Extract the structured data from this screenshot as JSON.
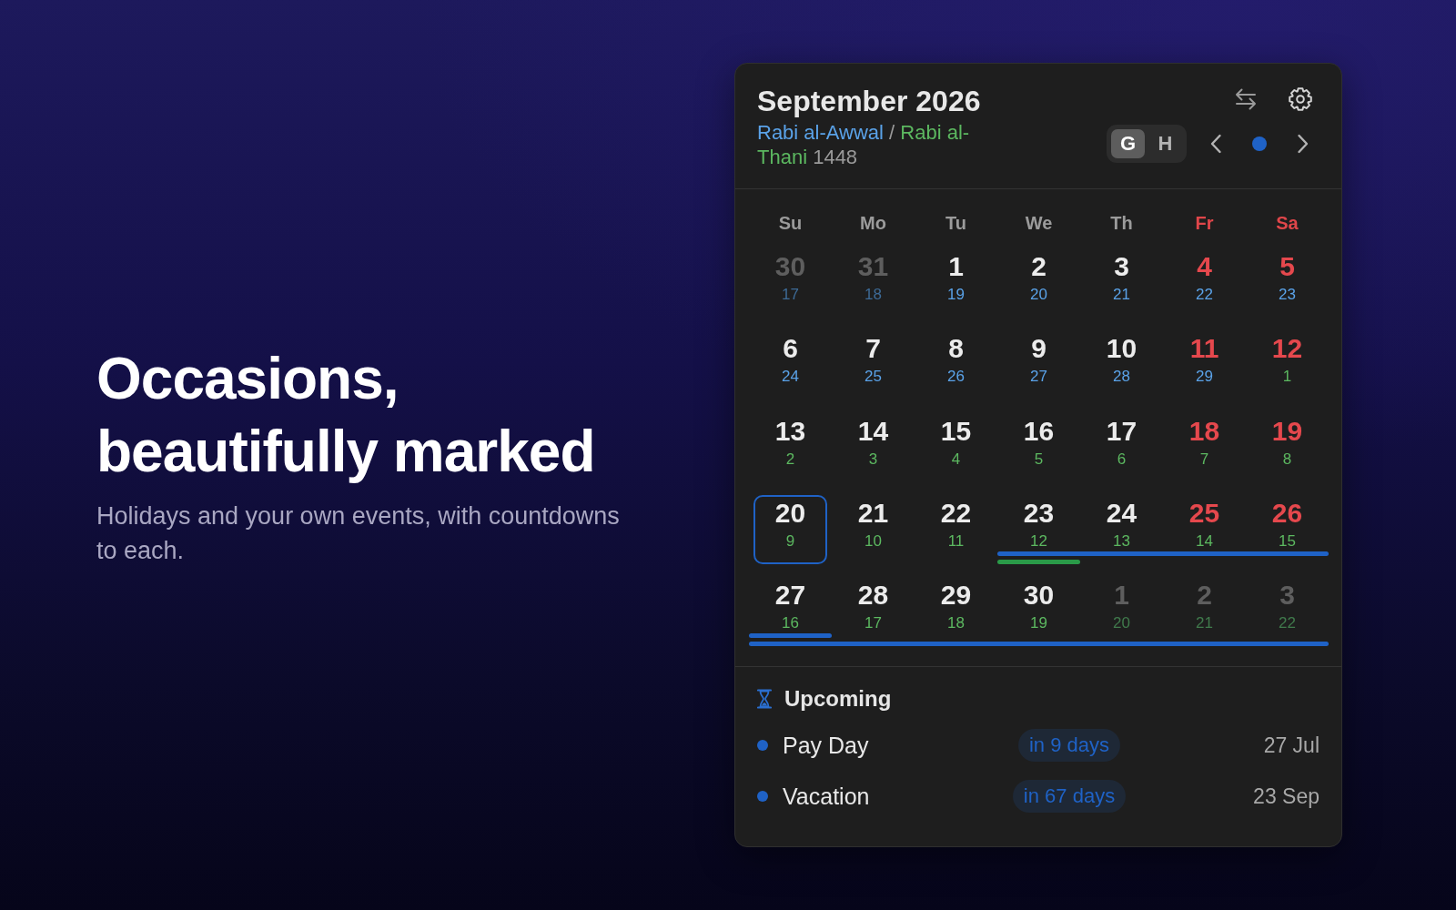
{
  "hero": {
    "headline": "Occasions, beautifully marked",
    "subtitle": "Holidays and your own events, with countdowns to each."
  },
  "calendar": {
    "title": "September 2026",
    "hijri_months": [
      {
        "name": "Rabi al-Awwal",
        "color": "#5aa2e8"
      },
      {
        "name": "Rabi al-Thani",
        "color": "#5cb860"
      }
    ],
    "hijri_separator": "/",
    "hijri_year": "1448",
    "modes": [
      {
        "label": "G",
        "selected": true
      },
      {
        "label": "H",
        "selected": false
      }
    ],
    "weekdays": [
      {
        "label": "Su",
        "weekend": false
      },
      {
        "label": "Mo",
        "weekend": false
      },
      {
        "label": "Tu",
        "weekend": false
      },
      {
        "label": "We",
        "weekend": false
      },
      {
        "label": "Th",
        "weekend": false
      },
      {
        "label": "Fr",
        "weekend": true
      },
      {
        "label": "Sa",
        "weekend": true
      }
    ],
    "weeks": [
      {
        "days": [
          {
            "date": "30",
            "hijri": "17",
            "color": "#3d6a96",
            "outside": true,
            "selected": false
          },
          {
            "date": "31",
            "hijri": "18",
            "color": "#3d6a96",
            "outside": true,
            "selected": false
          },
          {
            "date": "1",
            "hijri": "19",
            "color": "#5aa2e8",
            "outside": false,
            "selected": false
          },
          {
            "date": "2",
            "hijri": "20",
            "color": "#5aa2e8",
            "outside": false,
            "selected": false
          },
          {
            "date": "3",
            "hijri": "21",
            "color": "#5aa2e8",
            "outside": false,
            "selected": false
          },
          {
            "date": "4",
            "hijri": "22",
            "color": "#5aa2e8",
            "outside": false,
            "selected": false
          },
          {
            "date": "5",
            "hijri": "23",
            "color": "#5aa2e8",
            "outside": false,
            "selected": false
          }
        ]
      },
      {
        "days": [
          {
            "date": "6",
            "hijri": "24",
            "color": "#5aa2e8",
            "outside": false,
            "selected": false
          },
          {
            "date": "7",
            "hijri": "25",
            "color": "#5aa2e8",
            "outside": false,
            "selected": false
          },
          {
            "date": "8",
            "hijri": "26",
            "color": "#5aa2e8",
            "outside": false,
            "selected": false
          },
          {
            "date": "9",
            "hijri": "27",
            "color": "#5aa2e8",
            "outside": false,
            "selected": false
          },
          {
            "date": "10",
            "hijri": "28",
            "color": "#5aa2e8",
            "outside": false,
            "selected": false
          },
          {
            "date": "11",
            "hijri": "29",
            "color": "#5aa2e8",
            "outside": false,
            "selected": false
          },
          {
            "date": "12",
            "hijri": "1",
            "color": "#5cb860",
            "outside": false,
            "selected": false
          }
        ]
      },
      {
        "days": [
          {
            "date": "13",
            "hijri": "2",
            "color": "#5cb860",
            "outside": false,
            "selected": false
          },
          {
            "date": "14",
            "hijri": "3",
            "color": "#5cb860",
            "outside": false,
            "selected": false
          },
          {
            "date": "15",
            "hijri": "4",
            "color": "#5cb860",
            "outside": false,
            "selected": false
          },
          {
            "date": "16",
            "hijri": "5",
            "color": "#5cb860",
            "outside": false,
            "selected": false
          },
          {
            "date": "17",
            "hijri": "6",
            "color": "#5cb860",
            "outside": false,
            "selected": false
          },
          {
            "date": "18",
            "hijri": "7",
            "color": "#5cb860",
            "outside": false,
            "selected": false
          },
          {
            "date": "19",
            "hijri": "8",
            "color": "#5cb860",
            "outside": false,
            "selected": false
          }
        ]
      },
      {
        "days": [
          {
            "date": "20",
            "hijri": "9",
            "color": "#5cb860",
            "outside": false,
            "selected": true
          },
          {
            "date": "21",
            "hijri": "10",
            "color": "#5cb860",
            "outside": false,
            "selected": false
          },
          {
            "date": "22",
            "hijri": "11",
            "color": "#5cb860",
            "outside": false,
            "selected": false
          },
          {
            "date": "23",
            "hijri": "12",
            "color": "#5cb860",
            "outside": false,
            "selected": false,
            "bar_upper": {
              "color": "#1f62c6",
              "continues": true
            },
            "bar_lower": {
              "color": "#2a9a48",
              "continues": false
            }
          },
          {
            "date": "24",
            "hijri": "13",
            "color": "#5cb860",
            "outside": false,
            "selected": false
          },
          {
            "date": "25",
            "hijri": "14",
            "color": "#5cb860",
            "outside": false,
            "selected": false
          },
          {
            "date": "26",
            "hijri": "15",
            "color": "#5cb860",
            "outside": false,
            "selected": false
          }
        ]
      },
      {
        "days": [
          {
            "date": "27",
            "hijri": "16",
            "color": "#5cb860",
            "outside": false,
            "selected": false,
            "bar_upper": {
              "color": "#1f62c6",
              "continues": false
            },
            "bar_lower": {
              "color": "#1f62c6",
              "continues": true
            }
          },
          {
            "date": "28",
            "hijri": "17",
            "color": "#5cb860",
            "outside": false,
            "selected": false
          },
          {
            "date": "29",
            "hijri": "18",
            "color": "#5cb860",
            "outside": false,
            "selected": false
          },
          {
            "date": "30",
            "hijri": "19",
            "color": "#5cb860",
            "outside": false,
            "selected": false
          },
          {
            "date": "1",
            "hijri": "20",
            "color": "#407a4c",
            "outside": true,
            "selected": false
          },
          {
            "date": "2",
            "hijri": "21",
            "color": "#407a4c",
            "outside": true,
            "selected": false
          },
          {
            "date": "3",
            "hijri": "22",
            "color": "#407a4c",
            "outside": true,
            "selected": false
          }
        ]
      }
    ]
  },
  "upcoming": {
    "title": "Upcoming",
    "events": [
      {
        "name": "Pay Day",
        "countdown": "in 9 days",
        "date": "27 Jul",
        "color": "#1f62c6"
      },
      {
        "name": "Vacation",
        "countdown": "in 67 days",
        "date": "23 Sep",
        "color": "#1f62c6"
      }
    ]
  }
}
